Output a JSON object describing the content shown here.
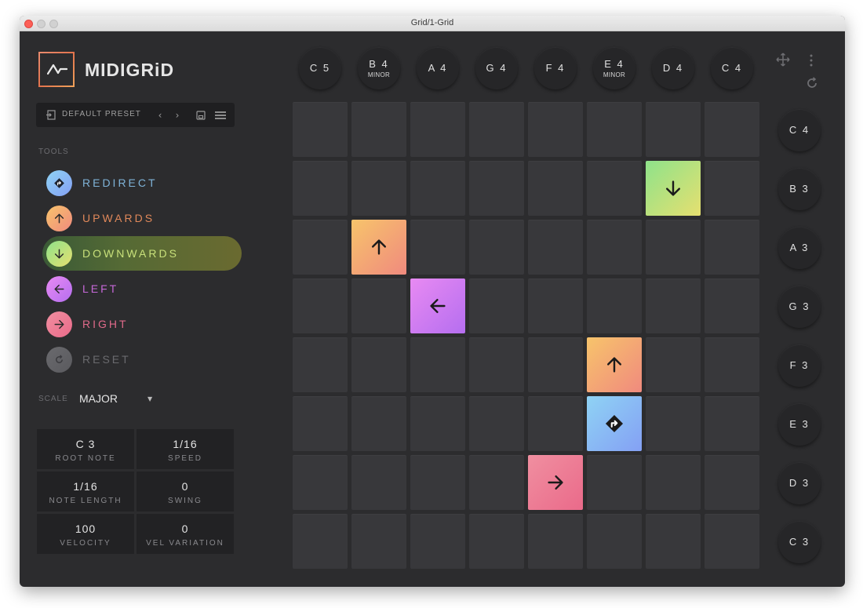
{
  "window": {
    "title": "Grid/1-Grid"
  },
  "app": {
    "logo_text": "MIDIGRiD"
  },
  "preset": {
    "name": "DEFAULT PRESET"
  },
  "tools": {
    "section_label": "TOOLS",
    "items": [
      {
        "label": "REDIRECT",
        "icon": "redirect-icon",
        "text_color": "#7fb3d8",
        "gradient": [
          "#8fd3f4",
          "#84a0f4"
        ],
        "active": false
      },
      {
        "label": "UPWARDS",
        "icon": "arrow-up-icon",
        "text_color": "#e0885a",
        "gradient": [
          "#f7c46b",
          "#f08a7e"
        ],
        "active": false
      },
      {
        "label": "DOWNWARDS",
        "icon": "arrow-down-icon",
        "text_color": "#c8e07a",
        "gradient": [
          "#8ee28a",
          "#e6e070"
        ],
        "active": true
      },
      {
        "label": "LEFT",
        "icon": "arrow-left-icon",
        "text_color": "#c668d8",
        "gradient": [
          "#e88af2",
          "#b56ef0"
        ],
        "active": false
      },
      {
        "label": "RIGHT",
        "icon": "arrow-right-icon",
        "text_color": "#e06a8a",
        "gradient": [
          "#f08fa0",
          "#ea6a8a"
        ],
        "active": false
      },
      {
        "label": "RESET",
        "icon": "reset-icon",
        "text_color": "#6a6a6e",
        "gradient": [
          "#6a6a6e",
          "#5a5a5e"
        ],
        "active": false
      }
    ]
  },
  "scale": {
    "label": "SCALE",
    "value": "MAJOR"
  },
  "params": [
    {
      "value": "C 3",
      "label": "ROOT NOTE"
    },
    {
      "value": "1/16",
      "label": "SPEED"
    },
    {
      "value": "1/16",
      "label": "NOTE LENGTH"
    },
    {
      "value": "0",
      "label": "SWING"
    },
    {
      "value": "100",
      "label": "VELOCITY"
    },
    {
      "value": "0",
      "label": "VEL VARIATION"
    }
  ],
  "column_notes": [
    {
      "note": "C 5",
      "mode": ""
    },
    {
      "note": "B 4",
      "mode": "MINOR"
    },
    {
      "note": "A 4",
      "mode": ""
    },
    {
      "note": "G 4",
      "mode": ""
    },
    {
      "note": "F 4",
      "mode": ""
    },
    {
      "note": "E 4",
      "mode": "MINOR"
    },
    {
      "note": "D 4",
      "mode": ""
    },
    {
      "note": "C 4",
      "mode": ""
    }
  ],
  "row_notes": [
    "C 4",
    "B 3",
    "A 3",
    "G 3",
    "F 3",
    "E 3",
    "D 3",
    "C 3"
  ],
  "grid": {
    "rows": 8,
    "cols": 8,
    "placed_tools": [
      {
        "row": 1,
        "col": 6,
        "tool": "downwards",
        "icon": "arrow-down-icon",
        "gradient": [
          "#8ee28a",
          "#e6e070"
        ]
      },
      {
        "row": 2,
        "col": 1,
        "tool": "upwards",
        "icon": "arrow-up-icon",
        "gradient": [
          "#f7c46b",
          "#f08a7e"
        ]
      },
      {
        "row": 3,
        "col": 2,
        "tool": "left",
        "icon": "arrow-left-icon",
        "gradient": [
          "#e88af2",
          "#b56ef0"
        ]
      },
      {
        "row": 4,
        "col": 5,
        "tool": "upwards",
        "icon": "arrow-up-icon",
        "gradient": [
          "#f7c46b",
          "#f08a7e"
        ]
      },
      {
        "row": 5,
        "col": 5,
        "tool": "redirect",
        "icon": "redirect-icon",
        "gradient": [
          "#8fd3f4",
          "#84a0f4"
        ]
      },
      {
        "row": 6,
        "col": 4,
        "tool": "right",
        "icon": "arrow-right-icon",
        "gradient": [
          "#f08fa0",
          "#ea6a8a"
        ]
      }
    ]
  }
}
